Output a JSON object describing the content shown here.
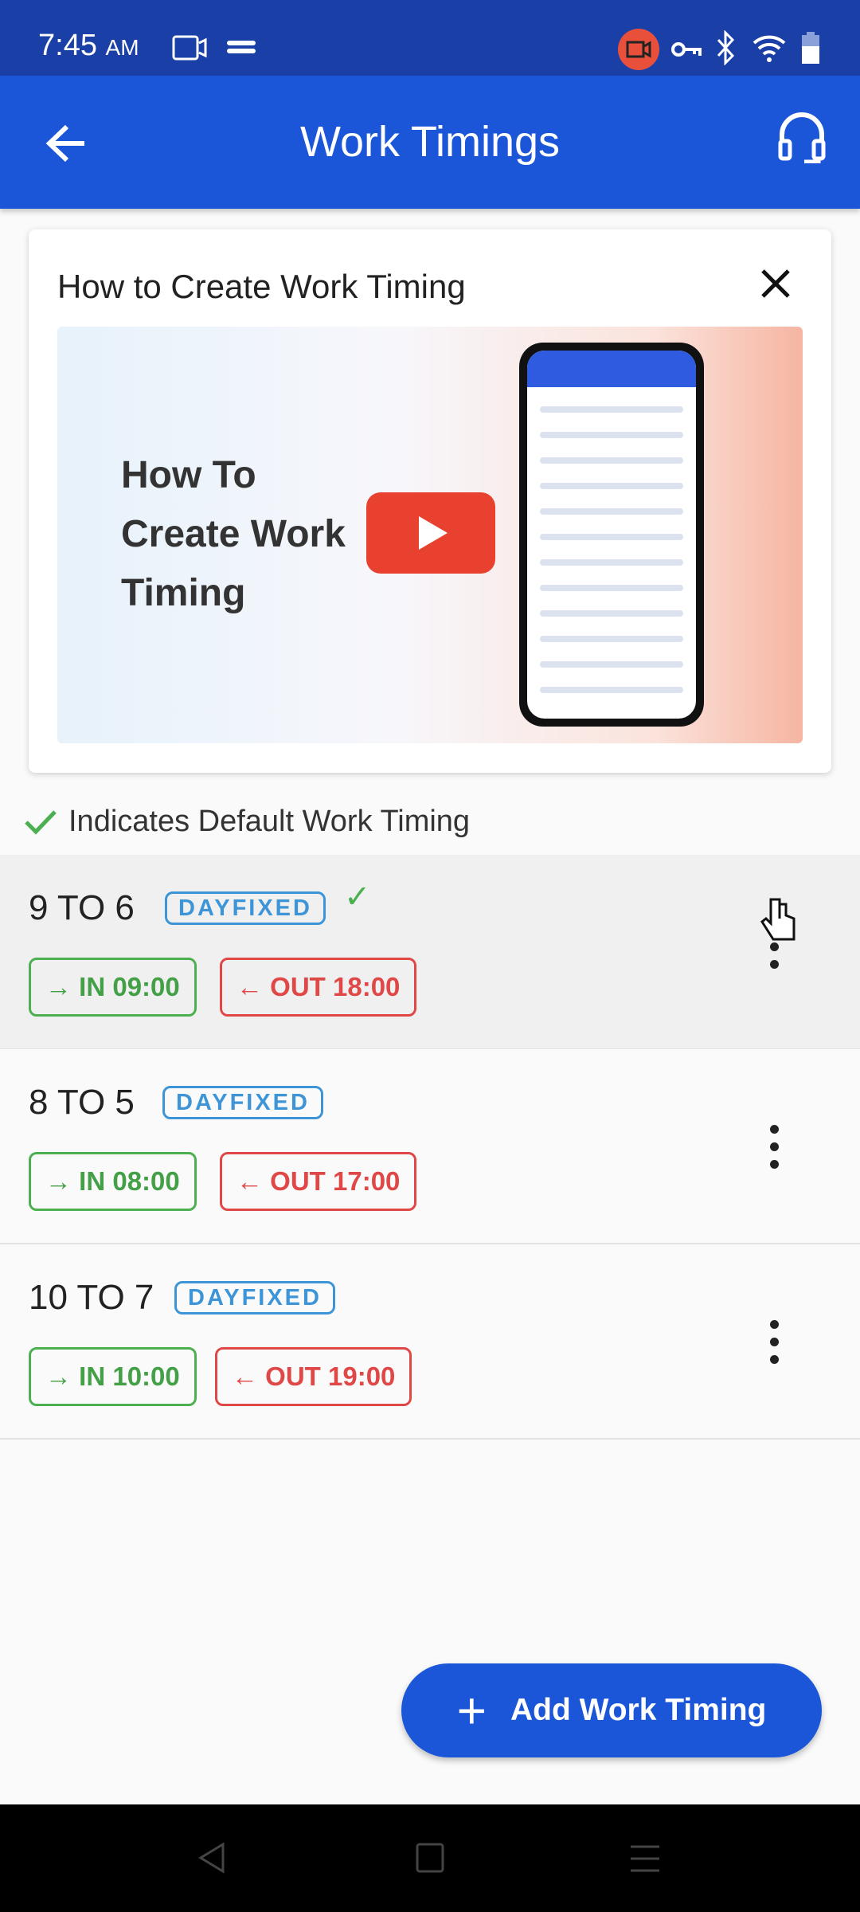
{
  "status_bar": {
    "time": "7:45",
    "ampm": "AM",
    "icons": [
      "screen-record-icon",
      "sync-icon",
      "camera-record-icon",
      "vpn-key-icon",
      "bluetooth-icon",
      "wifi-icon",
      "battery-icon"
    ]
  },
  "app_bar": {
    "title": "Work Timings",
    "back_icon": "arrow-left-icon",
    "support_icon": "headset-icon"
  },
  "video_card": {
    "title": "How to Create Work Timing",
    "thumbnail_text": [
      "How To",
      "Create Work",
      "Timing"
    ]
  },
  "indicator": {
    "text": "Indicates Default Work Timing"
  },
  "colors": {
    "primary": "#1b56d9",
    "in": "#43a047",
    "out": "#e04848",
    "badge": "#3d95d8"
  },
  "timings": [
    {
      "name": "9 TO 6",
      "type": "DAYFIXED",
      "in": "IN 09:00",
      "out": "OUT 18:00",
      "default": true
    },
    {
      "name": "8 TO 5",
      "type": "DAYFIXED",
      "in": "IN 08:00",
      "out": "OUT 17:00",
      "default": false
    },
    {
      "name": "10 TO 7",
      "type": "DAYFIXED",
      "in": "IN 10:00",
      "out": "OUT 19:00",
      "default": false
    }
  ],
  "fab": {
    "label": "Add Work Timing"
  }
}
